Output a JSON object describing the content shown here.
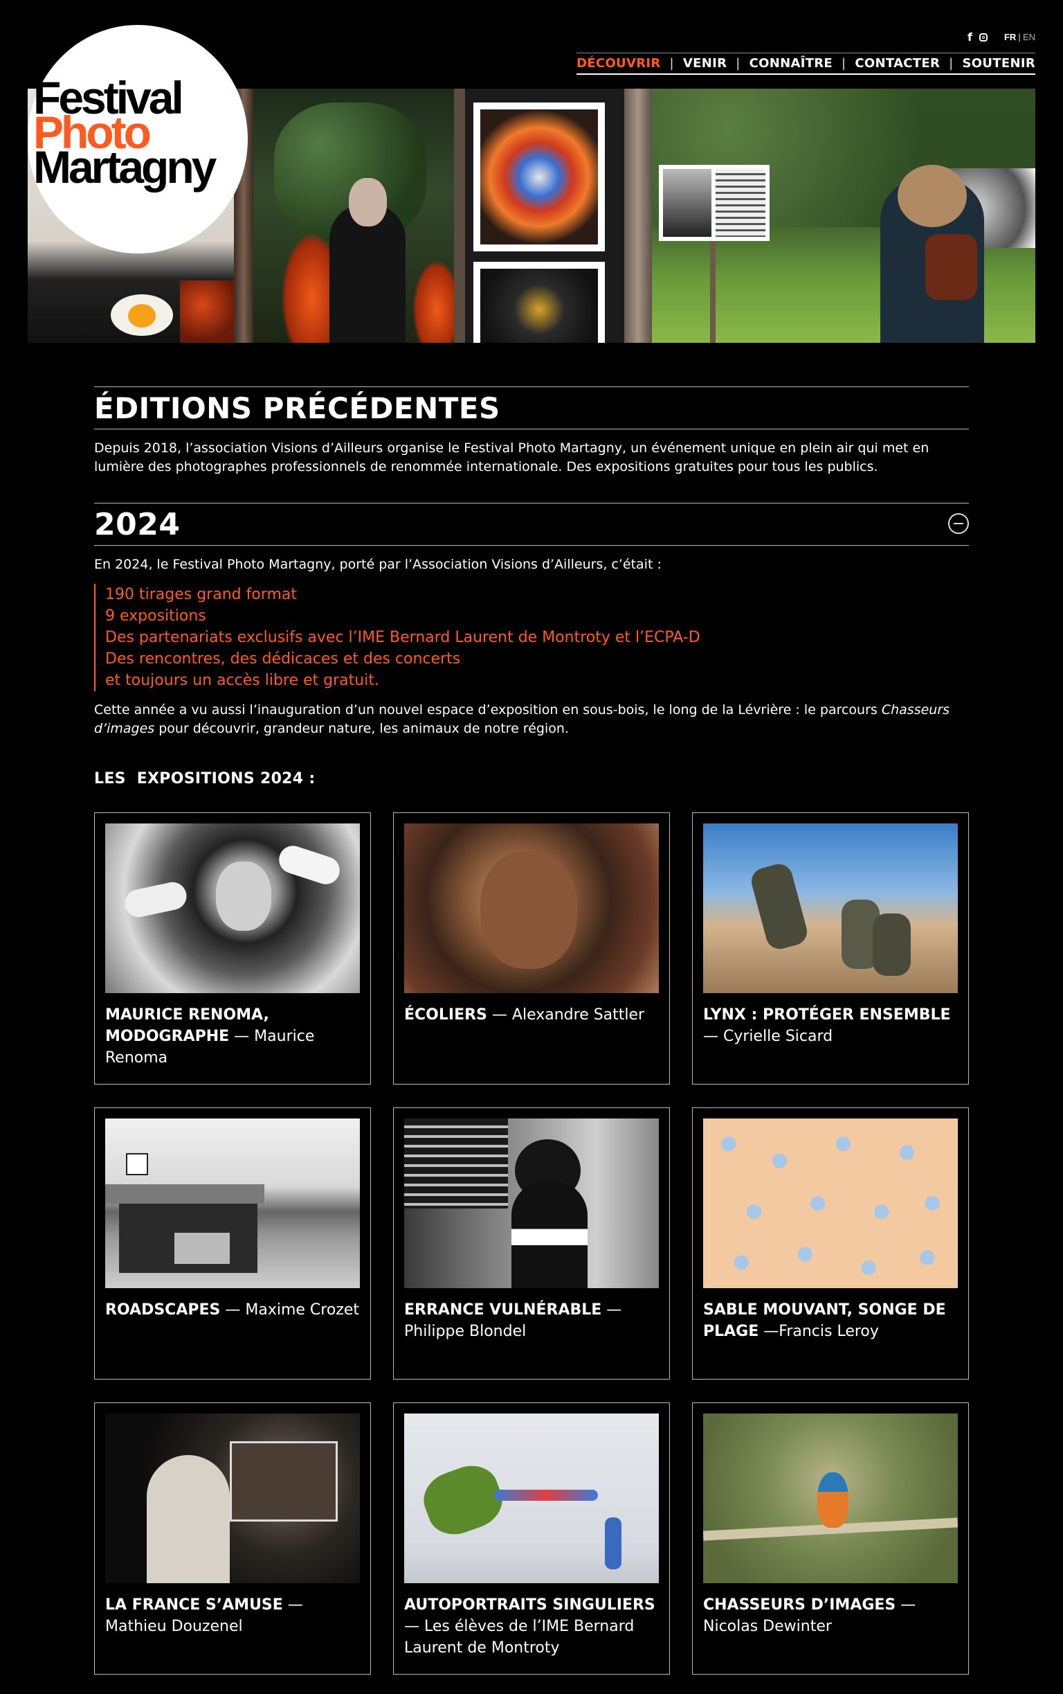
{
  "social": {
    "facebook_label": "f",
    "instagram_icon": "instagram-icon",
    "lang_fr": "FR",
    "lang_en": "EN"
  },
  "nav": {
    "items": [
      {
        "label": "DÉCOUVRIR",
        "active": true
      },
      {
        "label": "VENIR",
        "active": false
      },
      {
        "label": "CONNAÎTRE",
        "active": false
      },
      {
        "label": "CONTACTER",
        "active": false
      },
      {
        "label": "SOUTENIR",
        "active": false
      }
    ],
    "active_color": "#ff5a1f"
  },
  "logo": {
    "line1": "Festival",
    "line2": "Photo",
    "line3": "Martagny"
  },
  "page": {
    "title": "ÉDITIONS PRÉCÉDENTES",
    "intro": "Depuis 2018, l’association Visions d’Ailleurs organise le Festival Photo Martagny, un événement unique en plein air qui met en lumière des photographes professionnels de renommée internationale. Des expositions gratuites pour tous les publics."
  },
  "edition": {
    "year": "2024",
    "lead": "En 2024, le Festival Photo Martagny, porté par l’Association Visions d’Ailleurs, c’était :",
    "highlights": [
      "190 tirages grand format",
      "9 expositions",
      "Des partenariats exclusifs avec l’IME Bernard Laurent de Montroty et l’ECPA-D",
      "Des rencontres, des dédicaces et des concerts",
      "et toujours un accès libre et gratuit."
    ],
    "para_before": "Cette année a vu aussi l’inauguration d’un nouvel espace d’exposition en sous-bois, le long de la Lévrière : le parcours ",
    "para_em": "Chasseurs d’images",
    "para_after": " pour découvrir, grandeur nature, les animaux de notre région.",
    "exhibitions_heading": "LES  EXPOSITIONS 2024 :",
    "accent_color": "#ff5a1f"
  },
  "exhibitions": [
    {
      "title": "MAURICE RENOMA, MODOGRAPHE",
      "sep": " — ",
      "author": "Maurice Renoma"
    },
    {
      "title": "ÉCOLIERS",
      "sep": " — ",
      "author": "Alexandre Sattler"
    },
    {
      "title": "LYNX : PROTÉGER ENSEMBLE",
      "sep": " — ",
      "author": "Cyrielle Sicard"
    },
    {
      "title": "ROADSCAPES",
      "sep": " — ",
      "author": "Maxime Crozet"
    },
    {
      "title": "ERRANCE VULNÉRABLE",
      "sep": " — ",
      "author": "Philippe Blondel"
    },
    {
      "title": "SABLE MOUVANT, SONGE DE PLAGE",
      "sep": " —",
      "author": "Francis Leroy"
    },
    {
      "title": "LA FRANCE S’AMUSE",
      "sep": " — ",
      "author": "Mathieu Douzenel"
    },
    {
      "title": "AUTOPORTRAITS SINGULIERS",
      "sep": " — ",
      "author": "Les élèves de l’IME Bernard Laurent de Montroty"
    },
    {
      "title": "CHASSEURS D’IMAGES",
      "sep": " — ",
      "author": "Nicolas Dewinter"
    }
  ]
}
